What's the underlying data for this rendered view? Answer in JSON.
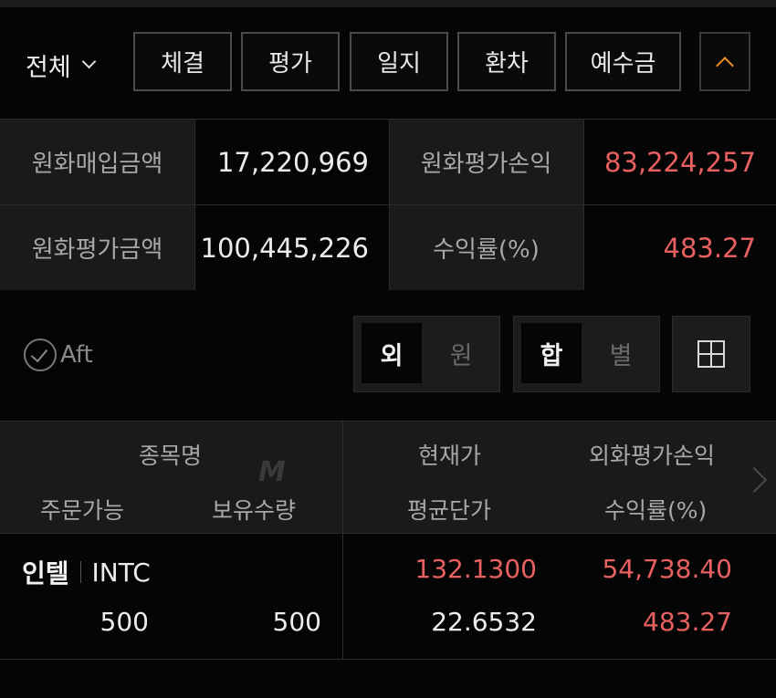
{
  "toolbar": {
    "scope_label": "전체",
    "buttons": [
      "체결",
      "평가",
      "일지",
      "환차",
      "예수금"
    ]
  },
  "summary": {
    "krw_purchase_label": "원화매입금액",
    "krw_purchase_value": "17,220,969",
    "krw_eval_pl_label": "원화평가손익",
    "krw_eval_pl_value": "83,224,257",
    "krw_eval_amount_label": "원화평가금액",
    "krw_eval_amount_value": "100,445,226",
    "return_rate_label": "수익률(%)",
    "return_rate_value": "483.27"
  },
  "controls": {
    "aft_label": "Aft",
    "currency_toggle": [
      "외",
      "원"
    ],
    "sum_toggle": [
      "합",
      "별"
    ]
  },
  "table": {
    "headers": {
      "stock_name": "종목명",
      "current_price": "현재가",
      "fx_eval_pl": "외화평가손익",
      "orderable": "주문가능",
      "holding_qty": "보유수량",
      "avg_price": "평균단가",
      "return_rate": "수익률(%)"
    },
    "watermark": "M",
    "rows": [
      {
        "name": "인텔",
        "ticker": "INTC",
        "current_price": "132.1300",
        "fx_eval_pl": "54,738.40",
        "orderable": "500",
        "holding_qty": "500",
        "avg_price": "22.6532",
        "return_rate": "483.27"
      }
    ]
  },
  "colors": {
    "profit_red": "#e86060",
    "accent_orange": "#f0902a",
    "background": "#050505",
    "label_cell": "#1a1a1c"
  }
}
